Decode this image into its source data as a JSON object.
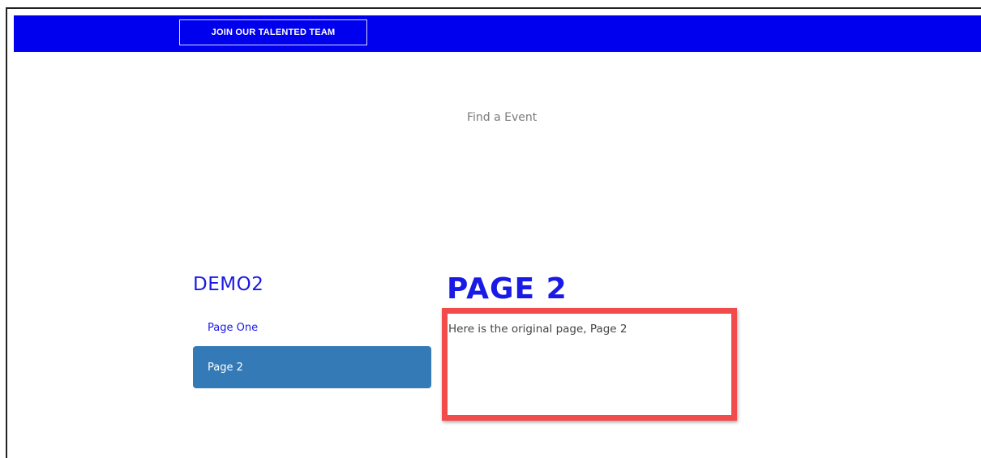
{
  "header": {
    "join_label": "JOIN OUR TALENTED TEAM",
    "bar_color": "#0000ee"
  },
  "hero": {
    "find_event_label": "Find a Event"
  },
  "sidebar": {
    "title": "DEMO2",
    "items": [
      {
        "label": "Page One",
        "active": false
      },
      {
        "label": "Page 2",
        "active": true
      }
    ],
    "active_color": "#337ab7"
  },
  "main": {
    "title": "PAGE 2",
    "body": "Here is the original page, Page 2"
  },
  "annotation": {
    "highlight_color": "#f24b4b"
  }
}
